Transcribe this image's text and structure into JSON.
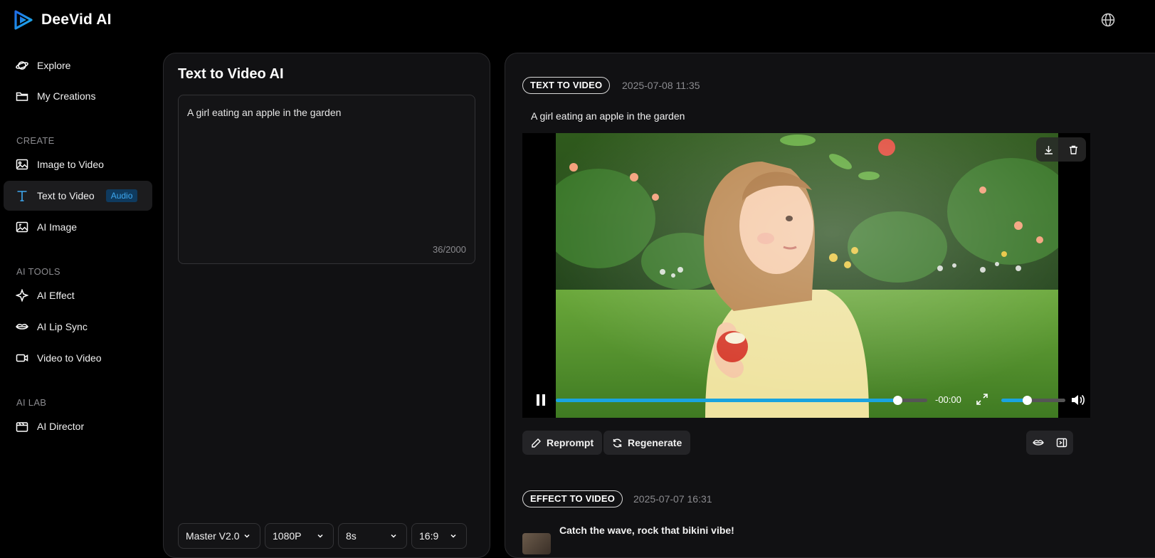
{
  "app": {
    "name": "DeeVid AI"
  },
  "header": {
    "language_icon": "globe-icon"
  },
  "sidebar": {
    "items": [
      {
        "label": "Explore",
        "icon": "planet-icon"
      },
      {
        "label": "My Creations",
        "icon": "folder-icon"
      }
    ],
    "sections": [
      {
        "title": "CREATE",
        "items": [
          {
            "label": "Image to Video",
            "icon": "image-icon"
          },
          {
            "label": "Text to Video",
            "icon": "text-icon",
            "badge": "Audio",
            "active": true
          },
          {
            "label": "AI Image",
            "icon": "ai-image-icon"
          }
        ]
      },
      {
        "title": "AI TOOLS",
        "items": [
          {
            "label": "AI Effect",
            "icon": "sparkle-icon"
          },
          {
            "label": "AI Lip Sync",
            "icon": "lips-icon"
          },
          {
            "label": "Video to Video",
            "icon": "video-camera-icon"
          }
        ]
      },
      {
        "title": "AI LAB",
        "items": [
          {
            "label": "AI Director",
            "icon": "director-icon"
          }
        ]
      }
    ]
  },
  "composer": {
    "title": "Text to Video AI",
    "prompt": "A girl eating an apple in the garden",
    "char_count": "36/2000",
    "model": "Master V2.0",
    "resolution": "1080P",
    "duration": "8s",
    "aspect_ratio": "16:9"
  },
  "results": [
    {
      "tag": "TEXT TO VIDEO",
      "timestamp": "2025-07-08 11:35",
      "caption": "A girl eating an apple in the garden",
      "player": {
        "time_remaining": "-00:00",
        "progress": 0.92,
        "volume": 0.4
      },
      "buttons": {
        "reprompt": "Reprompt",
        "regenerate": "Regenerate"
      }
    },
    {
      "tag": "EFFECT TO VIDEO",
      "timestamp": "2025-07-07 16:31",
      "caption": "Catch the wave, rock that bikini vibe!"
    }
  ],
  "colors": {
    "accent": "#1aa3e0",
    "badge_bg": "#0f3a5e",
    "badge_text": "#3ea8f0"
  }
}
